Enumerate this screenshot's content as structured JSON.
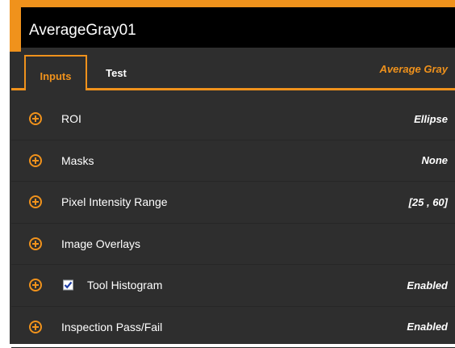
{
  "window": {
    "title": "AverageGray01"
  },
  "tabs": [
    {
      "label": "Inputs",
      "active": true
    },
    {
      "label": "Test",
      "active": false
    }
  ],
  "tool_type": "Average Gray",
  "rows": [
    {
      "label": "ROI",
      "value": "Ellipse"
    },
    {
      "label": "Masks",
      "value": "None"
    },
    {
      "label": "Pixel Intensity Range",
      "value": "[25 , 60]"
    },
    {
      "label": "Image Overlays",
      "value": ""
    },
    {
      "label": "Tool Histogram",
      "value": "Enabled",
      "checked": true
    },
    {
      "label": "Inspection Pass/Fail",
      "value": "Enabled"
    }
  ],
  "colors": {
    "accent": "#f0921c",
    "panel_bg": "#2e2e2e",
    "title_bg": "#000000",
    "checkbox_mark": "#1f3fa8"
  },
  "icons": {
    "expand": "plus-circle-icon",
    "check": "checkmark-icon"
  }
}
